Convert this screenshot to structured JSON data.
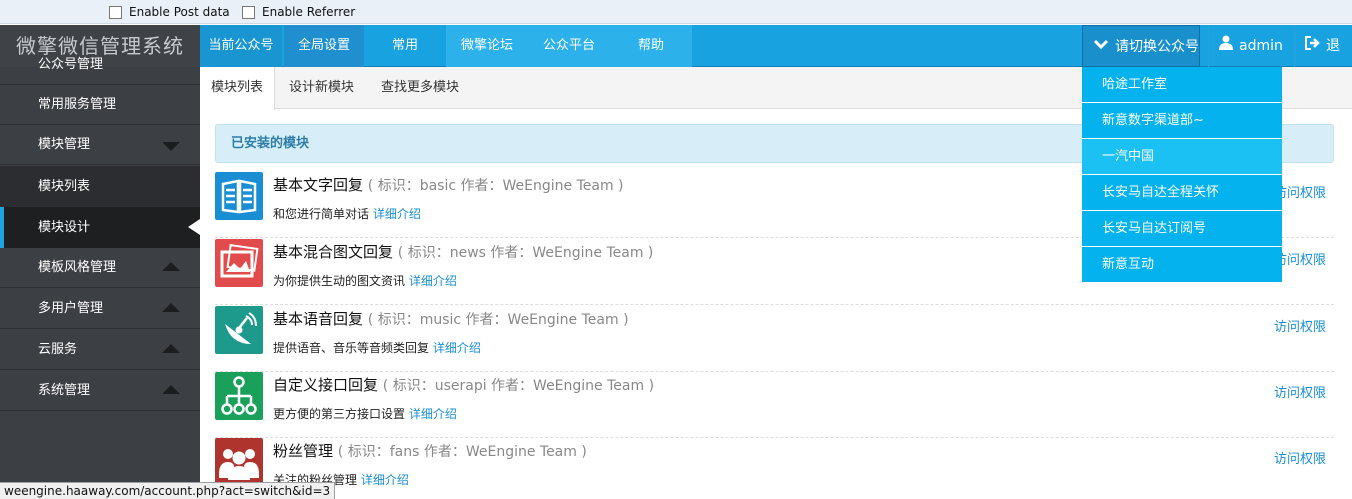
{
  "debug": {
    "post_label": "Enable Post data",
    "referrer_label": "Enable Referrer"
  },
  "brand": "微擎微信管理系统",
  "nav": {
    "current": "当前公众号",
    "items": [
      "全局设置",
      "常用",
      "微擎论坛",
      "公众平台",
      "帮助"
    ],
    "switch_account": "请切换公众号",
    "user": "admin",
    "logout": "退出"
  },
  "sidebar": {
    "partial": "公众号管理",
    "items": [
      "常用服务管理",
      "模块管理",
      "模板风格管理",
      "多用户管理",
      "云服务",
      "系统管理"
    ],
    "sub": [
      "模块列表",
      "模块设计"
    ]
  },
  "tabs": [
    "模块列表",
    "设计新模块",
    "查找更多模块"
  ],
  "installed_title": "已安装的模块",
  "modules": [
    {
      "name": "基本文字回复",
      "meta": "( 标识：basic   作者：WeEngine Team )",
      "desc": "和您进行简单对话",
      "more": "详细介绍",
      "perm": "访问权限",
      "color": "#1a8ed3",
      "icon": "text-icon"
    },
    {
      "name": "基本混合图文回复",
      "meta": "( 标识：news   作者：WeEngine Team )",
      "desc": "为你提供生动的图文资讯",
      "more": "详细介绍",
      "perm": "访问权限",
      "color": "#e24b4b",
      "icon": "picture-icon"
    },
    {
      "name": "基本语音回复",
      "meta": "( 标识：music   作者：WeEngine Team )",
      "desc": "提供语音、音乐等音频类回复",
      "more": "详细介绍",
      "perm": "访问权限",
      "color": "#1e9a8c",
      "icon": "dish-icon"
    },
    {
      "name": "自定义接口回复",
      "meta": "( 标识：userapi   作者：WeEngine Team )",
      "desc": "更方便的第三方接口设置",
      "more": "详细介绍",
      "perm": "访问权限",
      "color": "#19a05a",
      "icon": "network-icon"
    },
    {
      "name": "粉丝管理",
      "meta": "( 标识：fans   作者：WeEngine Team )",
      "desc": "关注的粉丝管理",
      "more": "详细介绍",
      "perm": "访问权限",
      "color": "#b0342e",
      "icon": "users-icon"
    }
  ],
  "dropdown": [
    "哈途工作室",
    "新意数字渠道部~",
    "一汽中国",
    "长安马自达全程关怀",
    "长安马自达订阅号",
    "新意互动"
  ],
  "status_url": "weengine.haaway.com/account.php?act=switch&id=3"
}
